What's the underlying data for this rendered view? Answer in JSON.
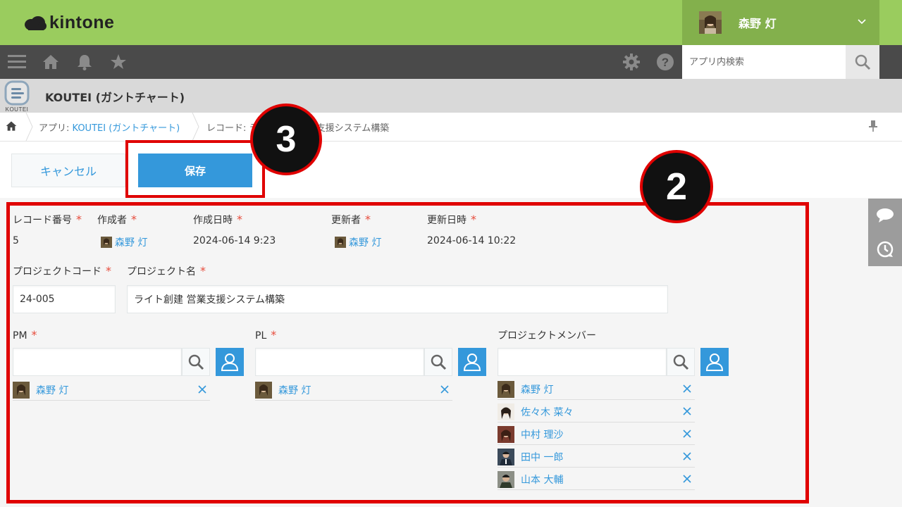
{
  "header": {
    "brand": "kintone",
    "user_name": "森野 灯"
  },
  "nav": {
    "search_placeholder": "アプリ内検索"
  },
  "app": {
    "icon_label": "KOUTEI",
    "title": "KOUTEI (ガントチャート)"
  },
  "breadcrumb": {
    "app_prefix": "アプリ: ",
    "app_link": "KOUTEI (ガントチャート)",
    "record_text": "レコード: ライト創建 営業支援システム構築"
  },
  "actions": {
    "cancel_label": "キャンセル",
    "save_label": "保存"
  },
  "form": {
    "record_number": {
      "label": "レコード番号",
      "value": "5"
    },
    "creator": {
      "label": "作成者",
      "value": "森野 灯"
    },
    "created_at": {
      "label": "作成日時",
      "value": "2024-06-14 9:23"
    },
    "updater": {
      "label": "更新者",
      "value": "森野 灯"
    },
    "updated_at": {
      "label": "更新日時",
      "value": "2024-06-14 10:22"
    },
    "project_code": {
      "label": "プロジェクトコード",
      "value": "24-005"
    },
    "project_name": {
      "label": "プロジェクト名",
      "value": "ライト創建 営業支援システム構築"
    },
    "pm": {
      "label": "PM",
      "users": [
        "森野 灯"
      ]
    },
    "pl": {
      "label": "PL",
      "users": [
        "森野 灯"
      ]
    },
    "members": {
      "label": "プロジェクトメンバー",
      "users": [
        "森野 灯",
        "佐々木 菜々",
        "中村 理沙",
        "田中 一郎",
        "山本 大輔"
      ]
    },
    "required_mark": "*"
  },
  "annotations": {
    "callout_2": "2",
    "callout_3": "3"
  },
  "colors": {
    "header_green": "#9acc5e",
    "user_box_green": "#83b04c",
    "nav_dark": "#4a4a4a",
    "link_blue": "#3498db",
    "highlight_red": "#e00000"
  }
}
